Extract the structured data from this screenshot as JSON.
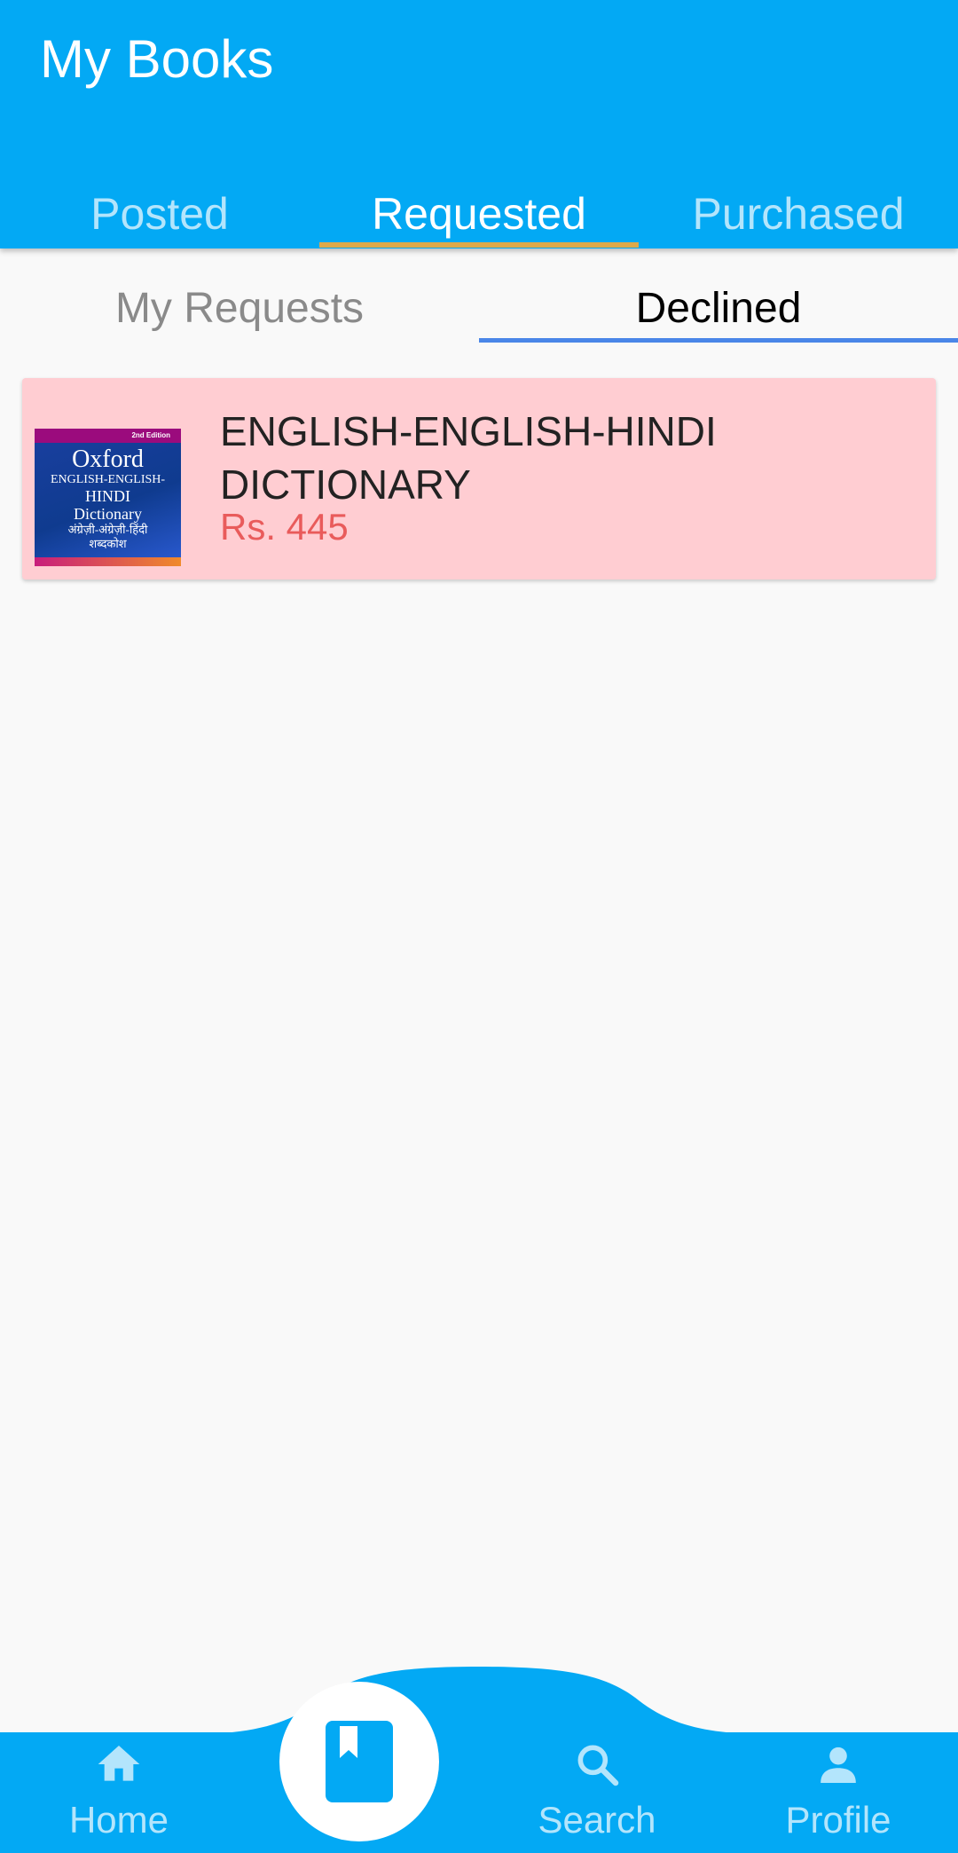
{
  "app_bar": {
    "title": "My Books"
  },
  "main_tabs": [
    {
      "label": "Posted"
    },
    {
      "label": "Requested",
      "active": true
    },
    {
      "label": "Purchased"
    }
  ],
  "sub_tabs": [
    {
      "label": "My Requests"
    },
    {
      "label": "Declined",
      "active": true
    }
  ],
  "books": [
    {
      "title": "ENGLISH-ENGLISH-HINDI DICTIONARY",
      "price": "Rs. 445",
      "cover": {
        "edition": "2nd Edition",
        "brand": "Oxford",
        "line1": "ENGLISH-ENGLISH-",
        "line2": "HINDI",
        "line3": "Dictionary",
        "hindi1": "अंग्रेज़ी-अंग्रेज़ी-हिंदी",
        "hindi2": "शब्दकोश"
      }
    }
  ],
  "bottom_nav": {
    "home": {
      "label": "Home",
      "icon": "home-icon"
    },
    "center": {
      "icon": "book-icon"
    },
    "search": {
      "label": "Search",
      "icon": "search-icon"
    },
    "profile": {
      "label": "Profile",
      "icon": "person-icon"
    }
  },
  "colors": {
    "primary": "#03a9f4",
    "tab_indicator": "#e0a94a",
    "sub_tab_indicator": "#4a86e8",
    "card_background": "#ffcdd2",
    "price": "#e95b5b"
  }
}
